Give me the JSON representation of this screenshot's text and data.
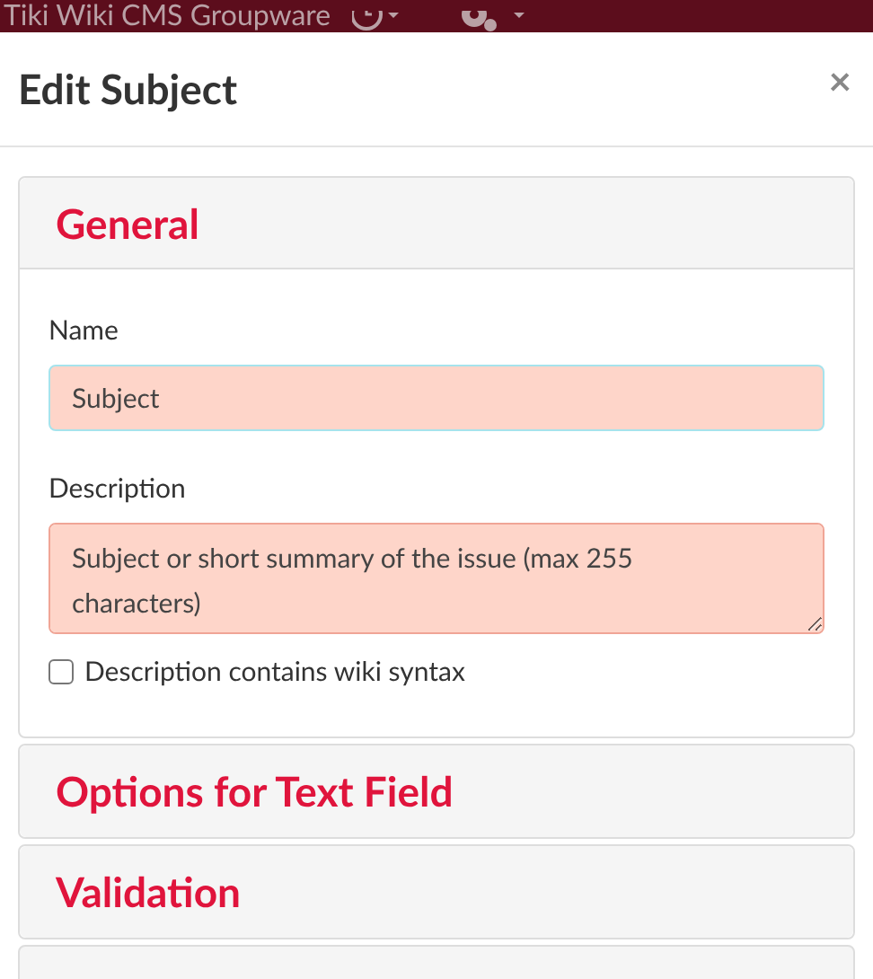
{
  "top_bar": {
    "title": "Tiki Wiki CMS Groupware"
  },
  "modal": {
    "title": "Edit Subject",
    "close": "×"
  },
  "sections": [
    {
      "title": "General",
      "expanded": true,
      "fields": [
        {
          "kind": "input",
          "label": "Name",
          "value": "Subject",
          "focused": true
        },
        {
          "kind": "textarea",
          "label": "Description",
          "value": "Subject or short summary of the issue (max 255 characters)",
          "focused": false
        },
        {
          "kind": "checkbox",
          "label": "Description contains wiki syntax",
          "checked": false
        }
      ]
    },
    {
      "title": "Options for Text Field",
      "expanded": false
    },
    {
      "title": "Validation",
      "expanded": false
    }
  ]
}
